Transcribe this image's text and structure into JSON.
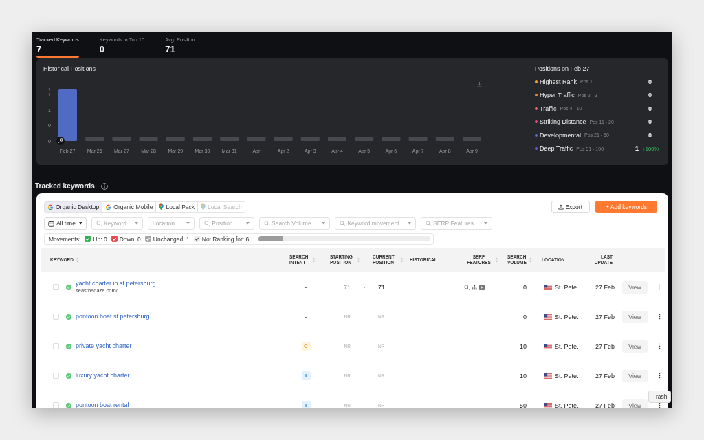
{
  "stats": [
    {
      "label": "Tracked Keywords",
      "value": "7",
      "selected": true
    },
    {
      "label": "Keywords in Top 10",
      "value": "0",
      "selected": false
    },
    {
      "label": "Avg. Position",
      "value": "71",
      "selected": false
    }
  ],
  "historical": {
    "title": "Historical Positions",
    "chart_data": {
      "type": "bar",
      "categories": [
        "Feb 27",
        "Mar 26",
        "Mar 27",
        "Mar 28",
        "Mar 29",
        "Mar 30",
        "Mar 31",
        "Apr",
        "Apr 2",
        "Apr 3",
        "Apr 4",
        "Apr 5",
        "Apr 6",
        "Apr 7",
        "Apr 8",
        "Apr 9"
      ],
      "values": [
        1,
        null,
        null,
        null,
        null,
        null,
        null,
        null,
        null,
        null,
        null,
        null,
        null,
        null,
        null,
        null
      ],
      "ylim": [
        0,
        1
      ],
      "yticks": [
        {
          "value": 1,
          "label": "1"
        },
        {
          "value": 0.9,
          "label": "1"
        },
        {
          "value": 0.6,
          "label": "1"
        },
        {
          "value": 0.3,
          "label": "0"
        },
        {
          "value": 0,
          "label": "0"
        }
      ]
    }
  },
  "positions": {
    "title": "Positions on Feb 27",
    "items": [
      {
        "name": "Highest Rank",
        "range": "Pos 1",
        "count": "0",
        "color": "#f2a33a"
      },
      {
        "name": "Hyper Traffic",
        "range": "Pos 2 - 3",
        "count": "0",
        "color": "#e8893c"
      },
      {
        "name": "Traffic",
        "range": "Pos 4 - 10",
        "count": "0",
        "color": "#f26b5e"
      },
      {
        "name": "Striking Distance",
        "range": "Pos 11 - 20",
        "count": "0",
        "color": "#e84d86"
      },
      {
        "name": "Developmental",
        "range": "Pos 21 - 50",
        "count": "0",
        "color": "#5a6fd8"
      },
      {
        "name": "Deep Traffic",
        "range": "Pos 51 - 100",
        "count": "1",
        "change": "↑100%",
        "color": "#6b5fd3"
      }
    ]
  },
  "section_title": "Tracked keywords",
  "source_tabs": [
    {
      "label": "Organic Desktop",
      "kind": "google",
      "selected": true,
      "disabled": false
    },
    {
      "label": "Organic Mobile",
      "kind": "google",
      "selected": false,
      "disabled": false
    },
    {
      "label": "Local Pack",
      "kind": "pin",
      "selected": false,
      "disabled": false
    },
    {
      "label": "Local Search",
      "kind": "pin",
      "selected": false,
      "disabled": true
    }
  ],
  "actions": [
    {
      "label": "Export",
      "kind": "export"
    },
    {
      "label": "+ Add keywords",
      "kind": "primary"
    }
  ],
  "date_filter": {
    "value": "All time"
  },
  "filters": [
    {
      "placeholder": "Keyword",
      "kind": "search"
    },
    {
      "placeholder": "Location",
      "kind": "select"
    },
    {
      "placeholder": "Position",
      "kind": "search"
    },
    {
      "placeholder": "Search Volume",
      "kind": "search"
    },
    {
      "placeholder": "Keyword movement",
      "kind": "search"
    },
    {
      "placeholder": "SERP Features",
      "kind": "search"
    }
  ],
  "movements": {
    "label": "Movements:",
    "items": [
      {
        "label": "Up: 0",
        "checked": true,
        "color": "#2eb14b"
      },
      {
        "label": "Down: 0",
        "checked": true,
        "color": "#e5484d"
      },
      {
        "label": "Unchanged: 1",
        "checked": true,
        "color": "#a5a5a5"
      },
      {
        "label": "Not Ranking for: 6",
        "checked": true,
        "color": "#ececec"
      }
    ],
    "level": 0.14
  },
  "table": {
    "columns": [
      {
        "label": "KEYWORD",
        "sortable": true
      },
      {
        "label": "SEARCH INTENT",
        "sortable": true
      },
      {
        "label": "STARTING POSITION",
        "sortable": true
      },
      {
        "label": "CURRENT POSITION",
        "sortable": true
      },
      {
        "label": "HISTORICAL",
        "sortable": false
      },
      {
        "label": "SERP FEATURES",
        "sortable": true
      },
      {
        "label": "SEARCH VOLUME",
        "sortable": true
      },
      {
        "label": "LOCATION",
        "sortable": false
      },
      {
        "label": "LAST UPDATE",
        "sortable": false
      }
    ],
    "rows": [
      {
        "checked": false,
        "keyword": "yacht charter in st petersburg",
        "url": "seasthedaze.com/",
        "intent": {
          "label": "-"
        },
        "starting": "71",
        "change": "-",
        "current": "71",
        "ranked": true,
        "serp_features": [
          {
            "kind": "search"
          },
          {
            "kind": "sitemap"
          },
          {
            "kind": "video"
          }
        ],
        "volume": "0",
        "location": "St. Pete…",
        "updated": "27 Feb",
        "action": "View"
      },
      {
        "checked": false,
        "keyword": "pontoon boat st petersburg",
        "intent": {
          "label": "-"
        },
        "starting": "NR",
        "current": "NR",
        "ranked": false,
        "serp_features": [],
        "volume": "0",
        "location": "St. Pete…",
        "updated": "27 Feb",
        "action": "View"
      },
      {
        "checked": false,
        "keyword": "private yacht charter",
        "intent": {
          "label": "C",
          "color": "#fdf3e1"
        },
        "starting": "NR",
        "current": "NR",
        "ranked": false,
        "serp_features": [],
        "volume": "10",
        "location": "St. Pete…",
        "updated": "27 Feb",
        "action": "View"
      },
      {
        "checked": false,
        "keyword": "luxury yacht charter",
        "intent": {
          "label": "I",
          "color": "#e4f1fd"
        },
        "starting": "NR",
        "current": "NR",
        "ranked": false,
        "serp_features": [],
        "volume": "10",
        "location": "St. Pete…",
        "updated": "27 Feb",
        "action": "View"
      },
      {
        "checked": false,
        "keyword": "pontoon boat rental",
        "intent": {
          "label": "I",
          "color": "#e4f1fd"
        },
        "starting": "NR",
        "current": "NR",
        "ranked": false,
        "serp_features": [],
        "volume": "50",
        "location": "St. Pete…",
        "updated": "27 Feb",
        "action": "View"
      }
    ]
  },
  "tooltip": "Trash"
}
